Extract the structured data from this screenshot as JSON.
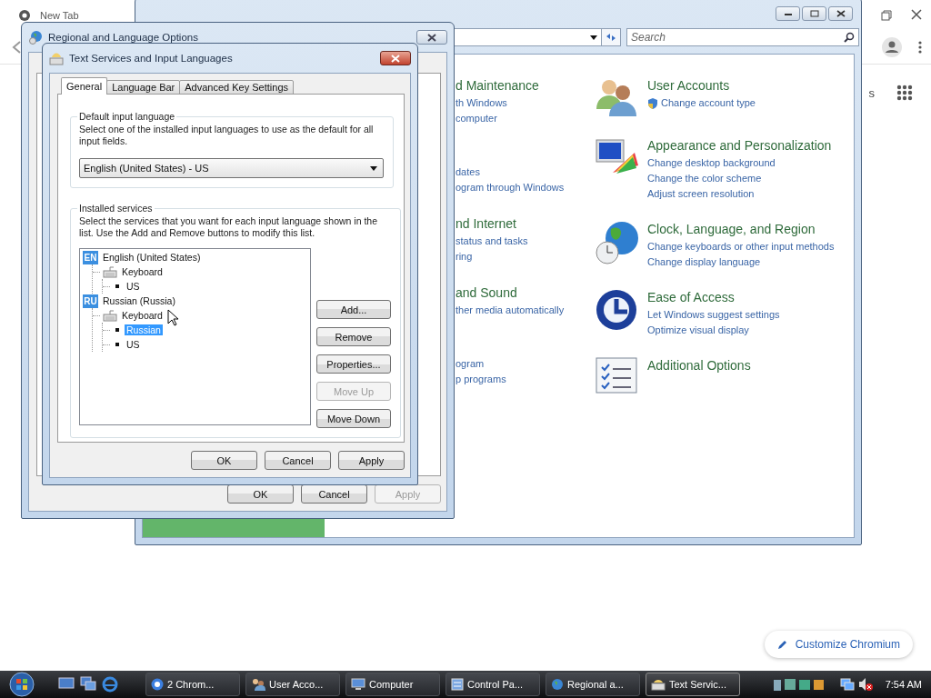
{
  "browser": {
    "tab_title": "New Tab",
    "partial_text": "s",
    "customize_button": "Customize Chromium"
  },
  "control_panel": {
    "search": {
      "placeholder": "Search"
    },
    "left_fragments": [
      {
        "title": "d Maintenance",
        "links": [
          "th Windows",
          "computer"
        ]
      },
      {
        "links": [
          "dates",
          "ogram through Windows"
        ]
      },
      {
        "title": "nd Internet",
        "links": [
          "status and tasks",
          "ring"
        ]
      },
      {
        "title": "and Sound",
        "links": [
          "ther media automatically"
        ]
      },
      {
        "links": [
          "ogram",
          "p programs"
        ]
      }
    ],
    "categories": [
      {
        "kind": "users",
        "title": "User Accounts",
        "links": [
          {
            "text": "Change account type",
            "shield": true
          }
        ]
      },
      {
        "kind": "appearance",
        "title": "Appearance and Personalization",
        "links": [
          {
            "text": "Change desktop background",
            "shield": false
          },
          {
            "text": "Change the color scheme",
            "shield": false
          },
          {
            "text": "Adjust screen resolution",
            "shield": false
          }
        ]
      },
      {
        "kind": "clock",
        "title": "Clock, Language, and Region",
        "links": [
          {
            "text": "Change keyboards or other input methods",
            "shield": false
          },
          {
            "text": "Change display language",
            "shield": false
          }
        ]
      },
      {
        "kind": "access",
        "title": "Ease of Access",
        "links": [
          {
            "text": "Let Windows suggest settings",
            "shield": false
          },
          {
            "text": "Optimize visual display",
            "shield": false
          }
        ]
      },
      {
        "kind": "options",
        "title": "Additional Options"
      }
    ]
  },
  "regional_dialog": {
    "title": "Regional and Language Options",
    "buttons": [
      {
        "label": "OK",
        "disabled": false
      },
      {
        "label": "Cancel",
        "disabled": false
      },
      {
        "label": "Apply",
        "disabled": true
      }
    ]
  },
  "text_services_dialog": {
    "title": "Text Services and Input Languages",
    "tabs": [
      {
        "label": "General",
        "selected": true
      },
      {
        "label": "Language Bar",
        "selected": false
      },
      {
        "label": "Advanced Key Settings",
        "selected": false
      }
    ],
    "default_language": {
      "heading": "Default input language",
      "description": "Select one of the installed input languages to use as the default for all input fields.",
      "value": "English (United States) - US"
    },
    "installed_services": {
      "heading": "Installed services",
      "description": "Select the services that you want for each input language shown in the list. Use the Add and Remove buttons to modify this list.",
      "tree": [
        {
          "kind": "language",
          "badge": "EN",
          "label": "English (United States)",
          "selected": false,
          "children": [
            {
              "kind": "keyboard",
              "label": "Keyboard",
              "selected": false,
              "children": [
                {
                  "kind": "layout",
                  "label": "US",
                  "selected": false
                }
              ]
            }
          ]
        },
        {
          "kind": "language",
          "badge": "RU",
          "label": "Russian (Russia)",
          "selected": false,
          "children": [
            {
              "kind": "keyboard",
              "label": "Keyboard",
              "selected": false,
              "children": [
                {
                  "kind": "layout",
                  "label": "Russian",
                  "selected": true
                },
                {
                  "kind": "layout",
                  "label": "US",
                  "selected": false
                }
              ]
            }
          ]
        }
      ],
      "side_buttons": [
        {
          "label": "Add...",
          "disabled": false
        },
        {
          "label": "Remove",
          "disabled": false
        },
        {
          "label": "Properties...",
          "disabled": false
        },
        {
          "label": "Move Up",
          "disabled": true
        },
        {
          "label": "Move Down",
          "disabled": false
        }
      ]
    },
    "buttons": [
      {
        "label": "OK",
        "disabled": false
      },
      {
        "label": "Cancel",
        "disabled": false
      },
      {
        "label": "Apply",
        "disabled": false
      }
    ]
  },
  "taskbar": {
    "items": [
      {
        "kind": "chrome",
        "label": "2 Chrom...",
        "selected": false
      },
      {
        "kind": "users",
        "label": "User Acco...",
        "selected": false
      },
      {
        "kind": "computer",
        "label": "Computer",
        "selected": false
      },
      {
        "kind": "control",
        "label": "Control Pa...",
        "selected": false
      },
      {
        "kind": "regional",
        "label": "Regional a...",
        "selected": false
      },
      {
        "kind": "text",
        "label": "Text Servic...",
        "selected": true
      }
    ],
    "clock": "7:54 AM"
  }
}
